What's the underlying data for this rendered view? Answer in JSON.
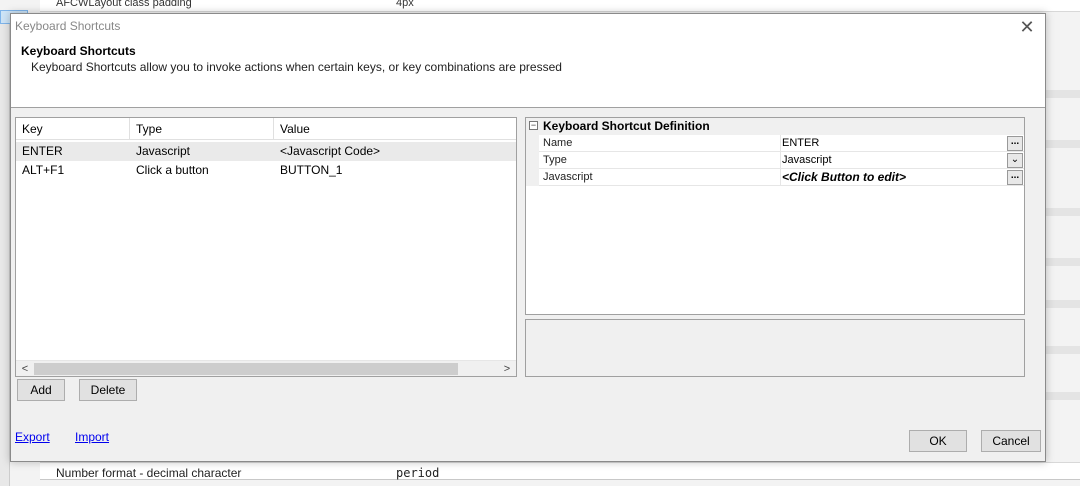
{
  "background": {
    "top_row_name": "AFCWLayout class padding",
    "top_row_value": "4px",
    "bottom_row_name": "Number format - decimal character",
    "bottom_row_value": "period"
  },
  "dialog": {
    "title": "Keyboard Shortcuts",
    "close_glyph": "✕",
    "header_title": "Keyboard Shortcuts",
    "header_desc": "Keyboard Shortcuts allow you to invoke actions when certain keys, or key combinations are pressed"
  },
  "list": {
    "columns": [
      "Key",
      "Type",
      "Value"
    ],
    "rows": [
      {
        "key": "ENTER",
        "type": "Javascript",
        "value": "<Javascript Code>"
      },
      {
        "key": "ALT+F1",
        "type": "Click a button",
        "value": "BUTTON_1"
      }
    ],
    "scroll_left": "<",
    "scroll_right": ">"
  },
  "buttons": {
    "add": "Add",
    "delete": "Delete",
    "ok": "OK",
    "cancel": "Cancel"
  },
  "links": {
    "export": "Export",
    "import": "Import"
  },
  "property_grid": {
    "category": "Keyboard Shortcut Definition",
    "expander": "−",
    "rows": [
      {
        "name": "Name",
        "value": "ENTER",
        "button": "..."
      },
      {
        "name": "Type",
        "value": "Javascript",
        "button": "⌄"
      },
      {
        "name": "Javascript",
        "value": "<Click Button to edit>",
        "button": "..."
      }
    ]
  }
}
